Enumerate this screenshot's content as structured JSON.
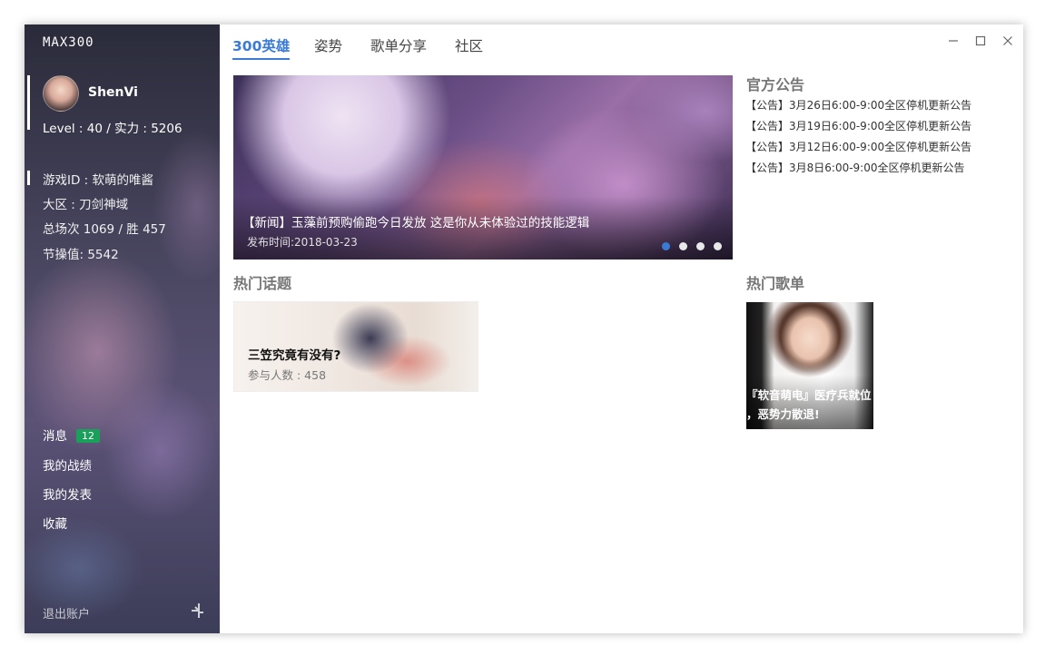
{
  "app": {
    "brand": "MAX300"
  },
  "user": {
    "name": "ShenVi",
    "level_line": "Level : 40 / 实力 : 5206",
    "game_id": "游戏ID : 软萌的唯酱",
    "region": "大区 : 刀剑神域",
    "record": "总场次 1069 / 胜 457",
    "integrity": "节操值: 5542"
  },
  "sidebar": {
    "items": [
      {
        "label": "消息",
        "badge": "12"
      },
      {
        "label": "我的战绩"
      },
      {
        "label": "我的发表"
      },
      {
        "label": "收藏"
      }
    ],
    "logout": "退出账户"
  },
  "tabs": [
    {
      "label": "300英雄",
      "active": true
    },
    {
      "label": "姿势"
    },
    {
      "label": "歌单分享"
    },
    {
      "label": "社区"
    }
  ],
  "banner": {
    "title": "【新闻】玉藻前预购偷跑今日发放 这是你从未体验过的技能逻辑",
    "date": "发布时间:2018-03-23",
    "dots": 4,
    "active_dot": 0
  },
  "announcements": {
    "title": "官方公告",
    "items": [
      "【公告】3月26日6:00-9:00全区停机更新公告",
      "【公告】3月19日6:00-9:00全区停机更新公告",
      "【公告】3月12日6:00-9:00全区停机更新公告",
      "【公告】3月8日6:00-9:00全区停机更新公告"
    ]
  },
  "hot_topics": {
    "title": "热门话题",
    "items": [
      {
        "title": "三笠究竟有没有?",
        "meta": "参与人数 : 458"
      }
    ]
  },
  "hot_playlists": {
    "title": "热门歌单",
    "items": [
      {
        "title_line1": "『软音萌电』医疗兵就位",
        "title_line2": "，恶势力散退!"
      }
    ]
  },
  "colors": {
    "accent": "#3a7bd5",
    "badge": "#1aa05a"
  },
  "icons": {
    "window_controls": [
      "minimize-icon",
      "maximize-icon",
      "close-icon"
    ],
    "sidebar_footer": "settings-icon"
  }
}
